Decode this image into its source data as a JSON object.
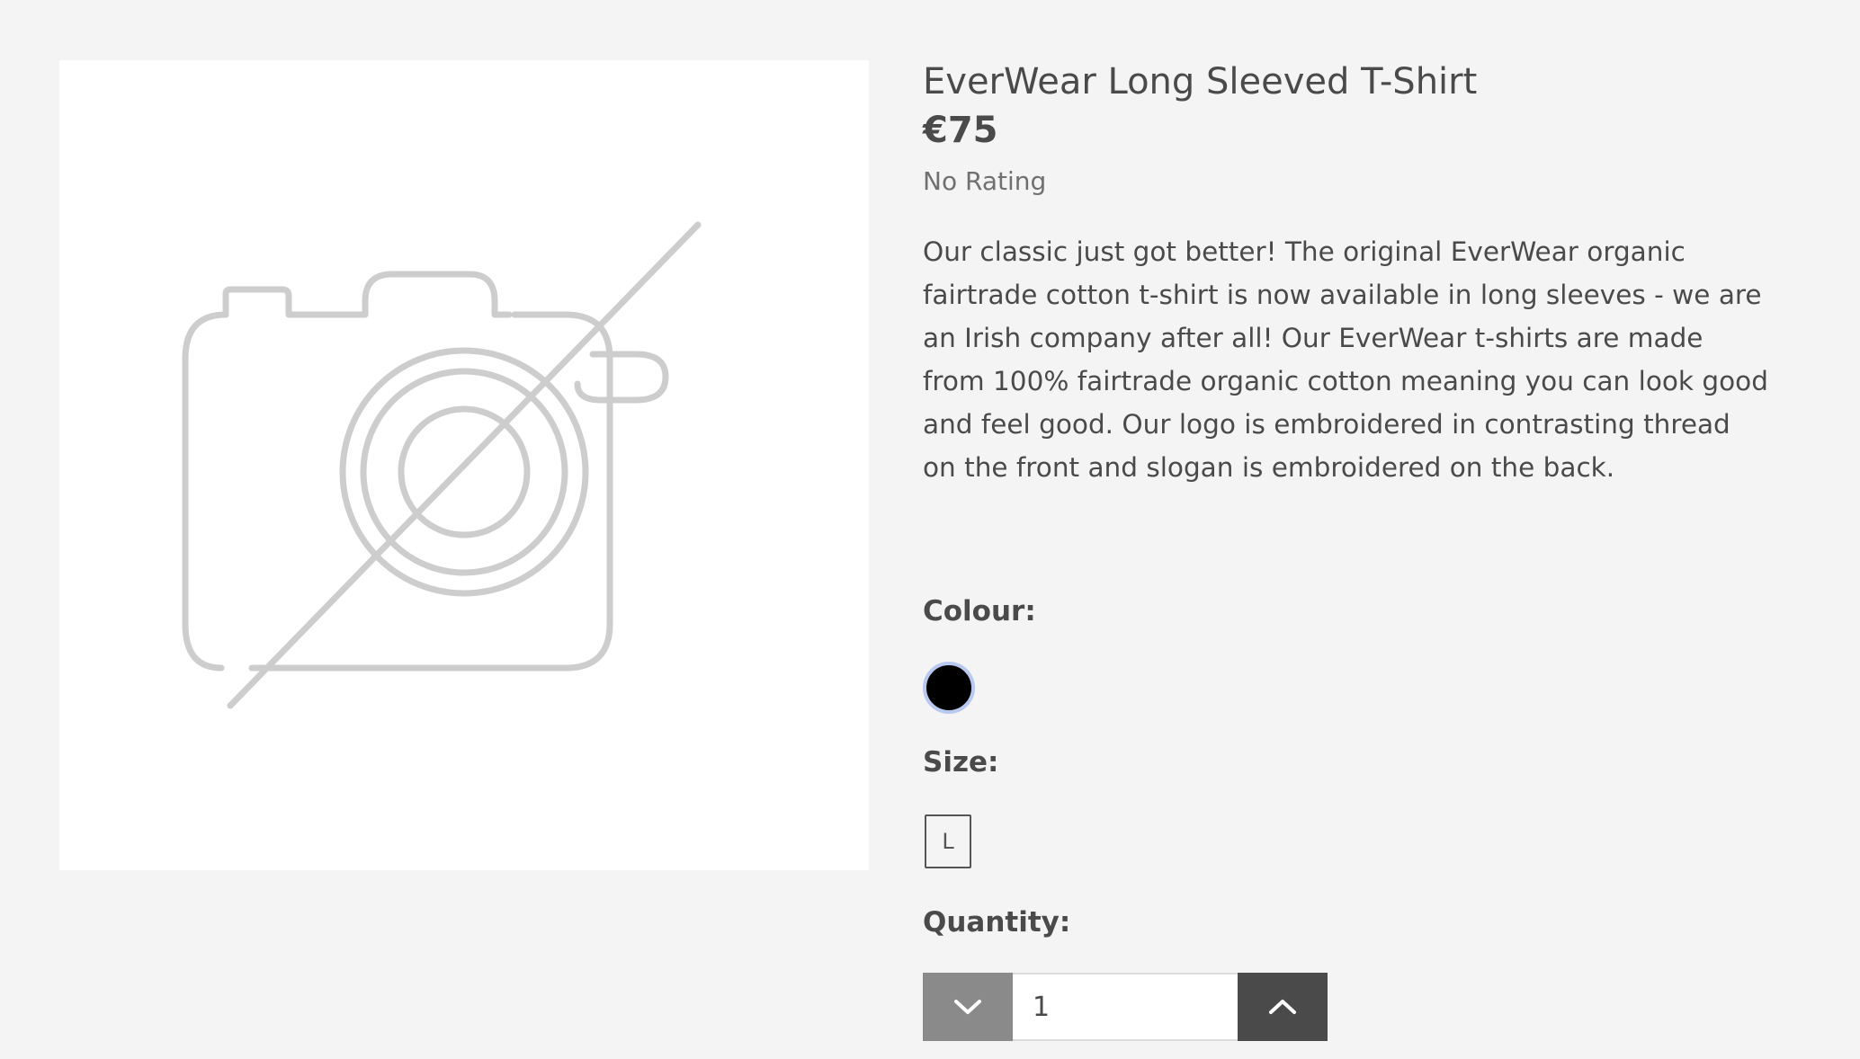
{
  "product": {
    "image_icon": "no-image-camera-icon",
    "title": "EverWear Long Sleeved T-Shirt",
    "price": "€75",
    "rating": "No Rating",
    "description": "Our classic just got better! The original EverWear organic fairtrade cotton t-shirt is now available in long sleeves - we are an Irish company after all! Our EverWear t-shirts are made from 100% fairtrade organic cotton meaning you can look good and feel good. Our logo is embroidered in contrasting thread on the front and slogan is embroidered on the back."
  },
  "options": {
    "colour_label": "Colour:",
    "colours": [
      {
        "name": "black",
        "hex": "#000000",
        "selected": true
      }
    ],
    "size_label": "Size:",
    "sizes": [
      "L"
    ]
  },
  "quantity": {
    "label": "Quantity:",
    "value": "1",
    "decrease_icon": "chevron-down-icon",
    "increase_icon": "chevron-up-icon"
  },
  "colors": {
    "background": "#f4f4f4",
    "text": "#4a4a4a",
    "decrease_button": "#8a8a8a",
    "increase_button": "#4a4a4a",
    "swatch_ring": "#b8c8ef"
  }
}
